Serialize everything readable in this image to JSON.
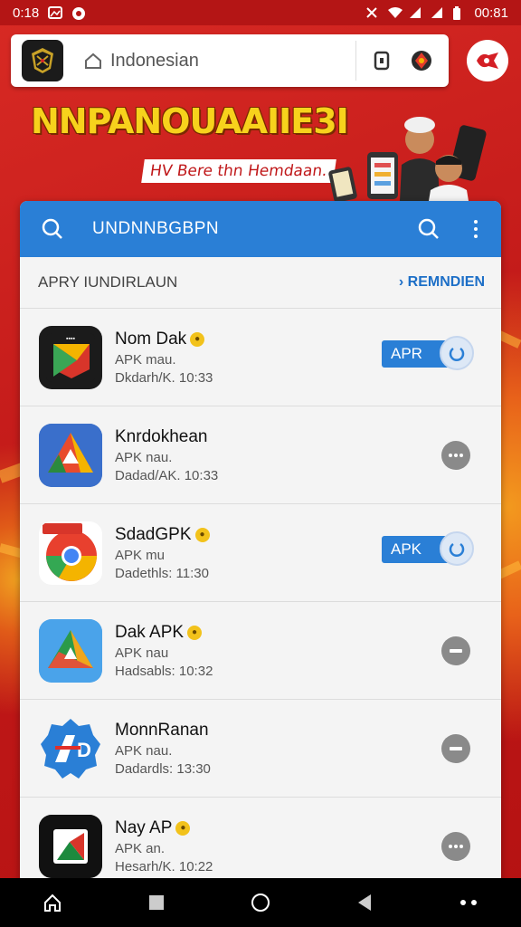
{
  "status": {
    "time": "0:18",
    "clock_right": "00:81"
  },
  "urlbar": {
    "url": "Indonesian"
  },
  "banner": {
    "title": "NNPANOUAAIIE3I",
    "subtitle": "HV Bere thn Hemdaan."
  },
  "card": {
    "header_title": "UNDNNBGBPN",
    "section_label": "APRY IUNDIRLAUN",
    "section_link": "› REMNDIEN",
    "items": [
      {
        "name": "Nom Dak",
        "sub": "APK mau.",
        "date": "Dkdarh/K. 10:33",
        "verified": true,
        "action": "APR"
      },
      {
        "name": "Knrdokhean",
        "sub": "APK nau.",
        "date": "Dadad/AK. 10:33",
        "verified": false,
        "action": ""
      },
      {
        "name": "SdadGPK",
        "sub": "APK mu",
        "date": "Dadethls: 11:30",
        "verified": true,
        "action": "APK"
      },
      {
        "name": "Dak APK",
        "sub": "APK nau",
        "date": "Hadsabls: 10:32",
        "verified": true,
        "action": ""
      },
      {
        "name": "MonnRanan",
        "sub": "APK nau.",
        "date": "Dadardls: 13:30",
        "verified": false,
        "action": ""
      },
      {
        "name": "Nay AP",
        "sub": "APK an.",
        "date": "Hesarh/K. 10:22",
        "verified": true,
        "action": ""
      }
    ]
  },
  "colors": {
    "accent": "#2a7fd6",
    "background": "#c81d1d",
    "banner_text": "#f7d21c"
  },
  "icons": [
    "home-icon",
    "square-recents-icon",
    "circle-home-icon",
    "back-triangle-icon",
    "more-dots-icon"
  ]
}
